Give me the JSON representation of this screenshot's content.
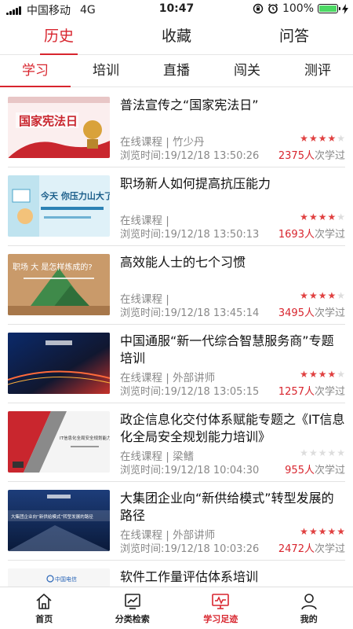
{
  "status": {
    "carrier": "中国移动",
    "network": "4G",
    "time": "10:47",
    "battery": "100%"
  },
  "top_tabs": [
    {
      "label": "历史",
      "active": true
    },
    {
      "label": "收藏",
      "active": false
    },
    {
      "label": "问答",
      "active": false
    }
  ],
  "sub_tabs": [
    {
      "label": "学习",
      "active": true
    },
    {
      "label": "培训",
      "active": false
    },
    {
      "label": "直播",
      "active": false
    },
    {
      "label": "闯关",
      "active": false
    },
    {
      "label": "测评",
      "active": false
    }
  ],
  "courses": [
    {
      "title": "普法宣传之“国家宪法日”",
      "meta": "在线课程 | 竹少丹",
      "viewed": "浏览时间:19/12/18 13:50:26",
      "rating": 4,
      "count": "2375人",
      "count_suffix": "次学过",
      "thumb_text": "国家宪法日"
    },
    {
      "title": "职场新人如何提高抗压能力",
      "meta": "在线课程 |",
      "viewed": "浏览时间:19/12/18 13:50:13",
      "rating": 4,
      "count": "1693人",
      "count_suffix": "次学过",
      "thumb_text": "今天 你压力山大了吗?"
    },
    {
      "title": "高效能人士的七个习惯",
      "meta": "在线课程 |",
      "viewed": "浏览时间:19/12/18 13:45:14",
      "rating": 4,
      "count": "3495人",
      "count_suffix": "次学过",
      "thumb_text": "职场 大 是怎样炼成的?"
    },
    {
      "title": "中国通服“新一代综合智慧服务商”专题培训",
      "meta": "在线课程 | 外部讲师",
      "viewed": "浏览时间:19/12/18 13:05:15",
      "rating": 4,
      "count": "1257人",
      "count_suffix": "次学过",
      "thumb_text": ""
    },
    {
      "title": "政企信息化交付体系赋能专题之《IT信息化全局安全规划能力培训》",
      "meta": "在线课程 | 梁鳍",
      "viewed": "浏览时间:19/12/18 10:04:30",
      "rating": 0,
      "count": "955人",
      "count_suffix": "次学过",
      "thumb_text": "IT信息化全局安全规划能力培训"
    },
    {
      "title": "大集团企业向“新供给模式”转型发展的路径",
      "meta": "在线课程 | 外部讲师",
      "viewed": "浏览时间:19/12/18 10:03:26",
      "rating": 5,
      "count": "2472人",
      "count_suffix": "次学过",
      "thumb_text": "大集团企业向“新供给模式”转型发展的路径"
    },
    {
      "title": "软件工作量评估体系培训",
      "meta": "",
      "viewed": "",
      "rating": 0,
      "count": "",
      "count_suffix": "",
      "thumb_text": "中国电信"
    }
  ],
  "bottom_nav": [
    {
      "label": "首页",
      "icon": "home-icon",
      "active": false
    },
    {
      "label": "分类检索",
      "icon": "chart-board-icon",
      "active": false
    },
    {
      "label": "学习足迹",
      "icon": "monitor-footprint-icon",
      "active": true
    },
    {
      "label": "我的",
      "icon": "person-icon",
      "active": false
    }
  ],
  "colors": {
    "accent": "#d8252e",
    "star_on": "#e04040",
    "star_off": "#dddddd"
  }
}
